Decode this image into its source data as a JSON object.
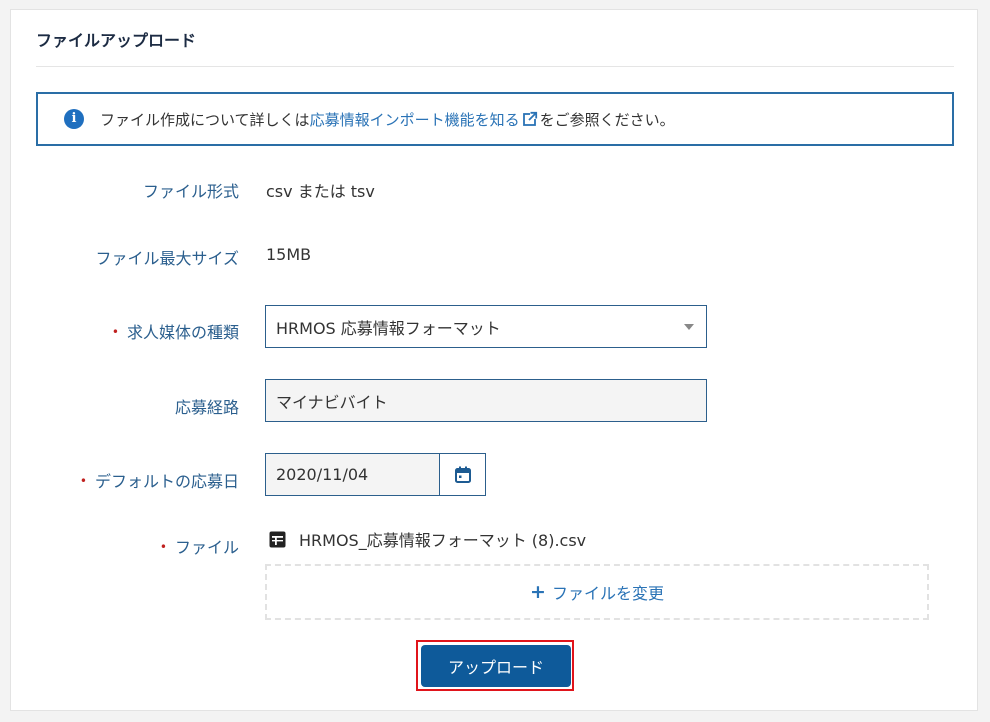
{
  "card": {
    "title": "ファイルアップロード"
  },
  "info": {
    "icon": "info-icon",
    "text_before": "ファイル作成について詳しくは",
    "link_text": "応募情報インポート機能を知る",
    "text_after": "をご参照ください。"
  },
  "form": {
    "file_format": {
      "label": "ファイル形式",
      "value": "csv または tsv"
    },
    "max_size": {
      "label": "ファイル最大サイズ",
      "value": "15MB"
    },
    "media_type": {
      "required_mark": "•",
      "label": "求人媒体の種類",
      "selected": "HRMOS 応募情報フォーマット"
    },
    "route": {
      "label": "応募経路",
      "value": "マイナビバイト"
    },
    "default_date": {
      "required_mark": "•",
      "label": "デフォルトの応募日",
      "value": "2020/11/04"
    },
    "file": {
      "required_mark": "•",
      "label": "ファイル",
      "filename": "HRMOS_応募情報フォーマット (8).csv",
      "change_label": "ファイルを変更",
      "change_prefix": "+"
    }
  },
  "actions": {
    "upload_label": "アップロード"
  },
  "colors": {
    "accent": "#0e5a9a",
    "link": "#2a73b6",
    "required": "#c0211f",
    "highlight": "#e0141b"
  }
}
